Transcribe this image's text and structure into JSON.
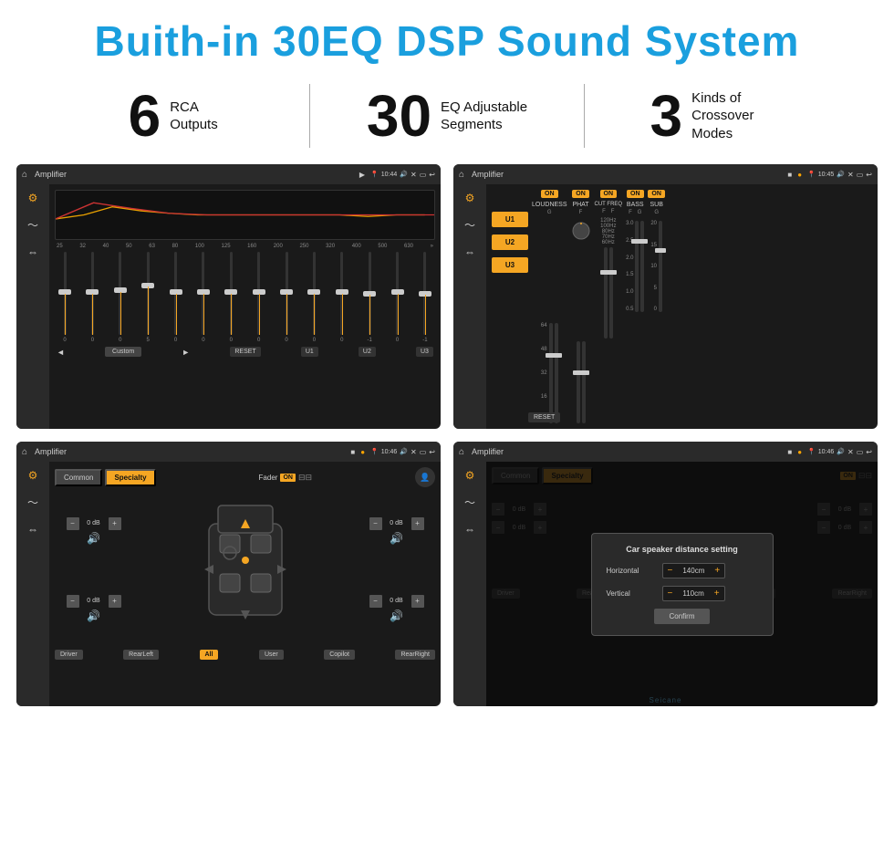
{
  "header": {
    "title": "Buith-in 30EQ DSP Sound System"
  },
  "stats": [
    {
      "number": "6",
      "label": "RCA\nOutputs"
    },
    {
      "number": "30",
      "label": "EQ Adjustable\nSegments"
    },
    {
      "number": "3",
      "label": "Kinds of\nCrossover Modes"
    }
  ],
  "screens": {
    "eq": {
      "title": "Amplifier",
      "time": "10:44",
      "freq_labels": [
        "25",
        "32",
        "40",
        "50",
        "63",
        "80",
        "100",
        "125",
        "160",
        "200",
        "250",
        "320",
        "400",
        "500",
        "630"
      ],
      "sliders": [
        {
          "val": "0",
          "pos": 50
        },
        {
          "val": "0",
          "pos": 50
        },
        {
          "val": "0",
          "pos": 52
        },
        {
          "val": "5",
          "pos": 45
        },
        {
          "val": "0",
          "pos": 50
        },
        {
          "val": "0",
          "pos": 50
        },
        {
          "val": "0",
          "pos": 50
        },
        {
          "val": "0",
          "pos": 50
        },
        {
          "val": "0",
          "pos": 50
        },
        {
          "val": "0",
          "pos": 50
        },
        {
          "val": "0",
          "pos": 50
        },
        {
          "val": "-1",
          "pos": 52
        },
        {
          "val": "0",
          "pos": 50
        },
        {
          "val": "-1",
          "pos": 52
        }
      ],
      "mode": "Custom",
      "buttons": [
        "RESET",
        "U1",
        "U2",
        "U3"
      ]
    },
    "amplifier": {
      "title": "Amplifier",
      "time": "10:45",
      "u_buttons": [
        "U1",
        "U2",
        "U3"
      ],
      "channels": [
        {
          "on": true,
          "name": "LOUDNESS",
          "sub": "G"
        },
        {
          "on": true,
          "name": "PHAT",
          "sub": "F"
        },
        {
          "on": true,
          "name": "CUT FREQ",
          "sub": "F"
        },
        {
          "on": true,
          "name": "BASS",
          "sub": "G"
        },
        {
          "on": true,
          "name": "SUB",
          "sub": "G"
        }
      ],
      "reset_label": "RESET"
    },
    "speaker": {
      "title": "Amplifier",
      "time": "10:46",
      "tabs": [
        "Common",
        "Specialty"
      ],
      "active_tab": "Specialty",
      "fader_label": "Fader",
      "fader_on": "ON",
      "cells": [
        {
          "label": "0 dB"
        },
        {
          "label": "0 dB"
        },
        {
          "label": "0 dB"
        },
        {
          "label": "0 dB"
        }
      ],
      "buttons": [
        "Driver",
        "RearLeft",
        "All",
        "User",
        "Copilot",
        "RearRight"
      ]
    },
    "distance": {
      "title": "Amplifier",
      "time": "10:46",
      "dialog": {
        "title": "Car speaker distance setting",
        "horizontal_label": "Horizontal",
        "horizontal_value": "140cm",
        "vertical_label": "Vertical",
        "vertical_value": "110cm",
        "confirm_label": "Confirm"
      },
      "tabs": [
        "Common",
        "Specialty"
      ],
      "active_tab": "Specialty",
      "buttons": [
        "Driver",
        "RearLeft",
        "User",
        "Copilot",
        "RearRight"
      ]
    }
  },
  "watermark": "Seicane"
}
